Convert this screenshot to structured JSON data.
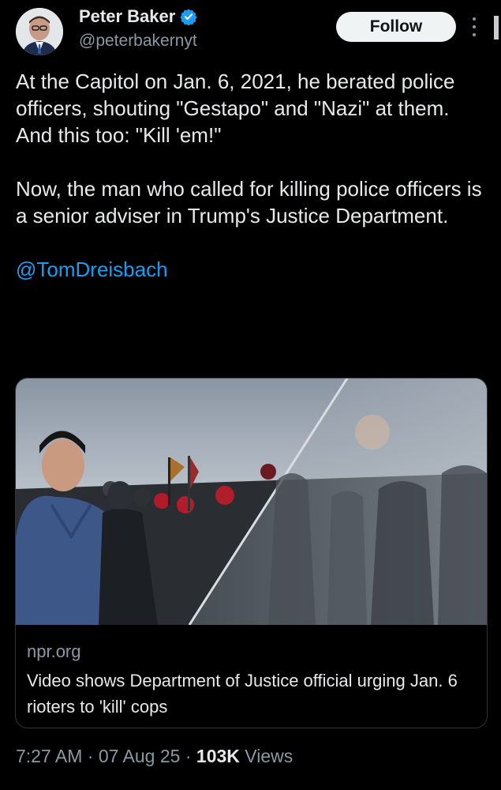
{
  "author": {
    "name": "Peter Baker",
    "handle": "@peterbakernyt",
    "verified_icon": "verified-badge-icon",
    "verified_color": "#1d9bf0"
  },
  "actions": {
    "follow_label": "Follow",
    "more_icon": "more-vertical-icon"
  },
  "tweet": {
    "paragraph1": "At the Capitol on Jan. 6, 2021, he berated police officers, shouting \"Gestapo\" and \"Nazi\" at them. And this too: \"Kill 'em!\"",
    "paragraph2": "Now, the man who called for killing police officers is a senior adviser in Trump's Justice Department.",
    "mention": "@TomDreisbach"
  },
  "link_card": {
    "domain": "npr.org",
    "title": "Video shows Department of Justice official urging Jan. 6 rioters to 'kill' cops"
  },
  "meta": {
    "time": "7:27 AM",
    "sep1": " · ",
    "date": "07 Aug 25",
    "sep2": " · ",
    "views_count": "103K",
    "views_label": " Views"
  },
  "colors": {
    "background": "#000000",
    "text": "#e7e9ea",
    "secondary": "#8b98a5",
    "link": "#1d9bf0"
  }
}
